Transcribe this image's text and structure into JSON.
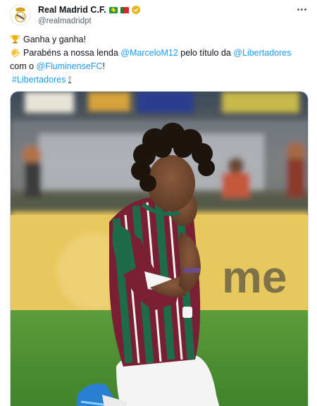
{
  "account": {
    "display_name": "Real Madrid C.F.",
    "handle": "@realmadridpt",
    "avatar_icon": "real-madrid-crest-icon",
    "badges": [
      "brazil-flag-icon",
      "portugal-flag-icon",
      "gold-verified-badge-icon"
    ]
  },
  "tweet": {
    "line1_text": "Ganha y ganha!",
    "line2_prefix": "Parabéns a nossa lenda ",
    "mention_marcelo": "@MarceloM12",
    "line2_middle": " pelo título da ",
    "mention_libertadores": "@Libertadores",
    "line3_prefix": "com o ",
    "mention_fluminense": "@FluminenseFC",
    "line3_suffix": "!",
    "hashtag": "#Libertadores",
    "emojis": [
      "trophy-icon",
      "clapping-hands-icon",
      "small-trophy-icon"
    ]
  },
  "media": {
    "banner_text": "me"
  },
  "colors": {
    "link": "#1d9bf0",
    "text": "#0f1419",
    "secondary": "#536471",
    "jersey_maroon": "#7a1f33",
    "jersey_green": "#1d6b4a"
  }
}
